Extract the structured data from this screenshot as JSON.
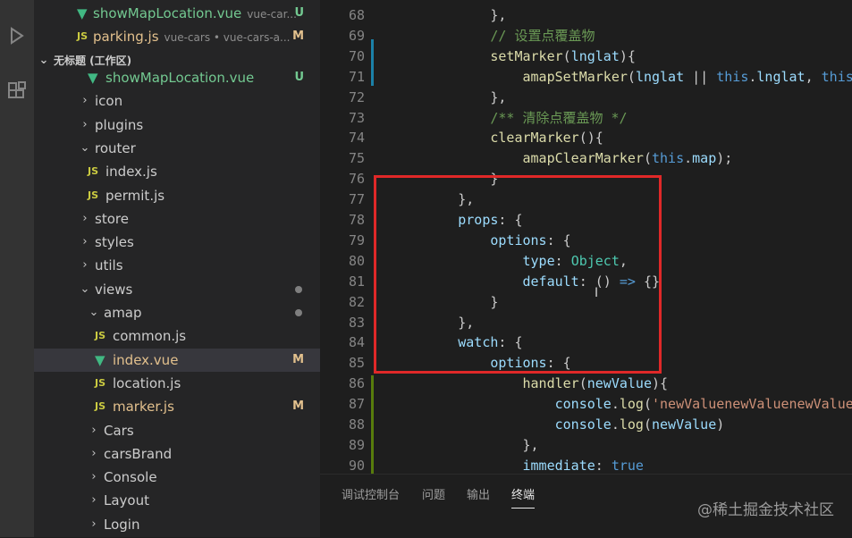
{
  "sidebar": {
    "section_title": "无标题 (工作区)",
    "open_editors": [
      {
        "label": "showMapLocation.vue",
        "desc": "vue-car...",
        "badge": "U",
        "icon": "vue"
      },
      {
        "label": "parking.js",
        "desc": "vue-cars • vue-cars-a...",
        "badge": "M",
        "icon": "js"
      }
    ],
    "tree": [
      {
        "label": "showMapLocation.vue",
        "badge": "U",
        "icon": "vue",
        "indent": 2
      },
      {
        "label": "icon",
        "chev": ">",
        "indent": 1
      },
      {
        "label": "plugins",
        "chev": ">",
        "indent": 1
      },
      {
        "label": "router",
        "chev": "v",
        "indent": 1
      },
      {
        "label": "index.js",
        "icon": "js",
        "indent": 2
      },
      {
        "label": "permit.js",
        "icon": "js",
        "indent": 2
      },
      {
        "label": "store",
        "chev": ">",
        "indent": 1
      },
      {
        "label": "styles",
        "chev": ">",
        "indent": 1
      },
      {
        "label": "utils",
        "chev": ">",
        "indent": 1
      },
      {
        "label": "views",
        "chev": "v",
        "indent": 1,
        "dot": true
      },
      {
        "label": "amap",
        "chev": "v",
        "indent": 2,
        "dot": true
      },
      {
        "label": "common.js",
        "icon": "js",
        "indent": 3
      },
      {
        "label": "index.vue",
        "icon": "vue",
        "indent": 3,
        "badge": "M",
        "selected": true
      },
      {
        "label": "location.js",
        "icon": "js",
        "indent": 3
      },
      {
        "label": "marker.js",
        "icon": "js",
        "indent": 3,
        "badge": "M"
      },
      {
        "label": "Cars",
        "chev": ">",
        "indent": 2
      },
      {
        "label": "carsBrand",
        "chev": ">",
        "indent": 2
      },
      {
        "label": "Console",
        "chev": ">",
        "indent": 2
      },
      {
        "label": "Layout",
        "chev": ">",
        "indent": 2
      },
      {
        "label": "Login",
        "chev": ">",
        "indent": 2
      }
    ],
    "icon_labels": {
      "js": "JS"
    }
  },
  "editor": {
    "lines": [
      {
        "n": "68",
        "t": "            },"
      },
      {
        "n": "69",
        "t": "            // 设置点覆盖物"
      },
      {
        "n": "70",
        "t": "            setMarker(lnglat){"
      },
      {
        "n": "71",
        "t": "                amapSetMarker(lnglat || this.lnglat, this.ma"
      },
      {
        "n": "72",
        "t": "            },"
      },
      {
        "n": "73",
        "t": "            /** 清除点覆盖物 */"
      },
      {
        "n": "74",
        "t": "            clearMarker(){"
      },
      {
        "n": "75",
        "t": "                amapClearMarker(this.map);"
      },
      {
        "n": "76",
        "t": "            }"
      },
      {
        "n": "77",
        "t": "        },"
      },
      {
        "n": "78",
        "t": "        props: {"
      },
      {
        "n": "79",
        "t": "            options: {"
      },
      {
        "n": "80",
        "t": "                type: Object,"
      },
      {
        "n": "81",
        "t": "                default: () => {}"
      },
      {
        "n": "82",
        "t": "            }"
      },
      {
        "n": "83",
        "t": "        },"
      },
      {
        "n": "84",
        "t": "        watch: {"
      },
      {
        "n": "85",
        "t": "            options: {"
      },
      {
        "n": "86",
        "t": "                handler(newValue){"
      },
      {
        "n": "87",
        "t": "                    console.log('newValuenewValuenewValuenew"
      },
      {
        "n": "88",
        "t": "                    console.log(newValue)"
      },
      {
        "n": "89",
        "t": "                },"
      },
      {
        "n": "90",
        "t": "                immediate: true"
      }
    ]
  },
  "panel": {
    "tabs": [
      "调试控制台",
      "问题",
      "输出",
      "终端"
    ],
    "active": "终端"
  },
  "watermark": "@稀土掘金技术社区",
  "colors": {
    "highlight_box": "#e02828",
    "accent_vue": "#41b883",
    "accent_js": "#cbcb41"
  }
}
